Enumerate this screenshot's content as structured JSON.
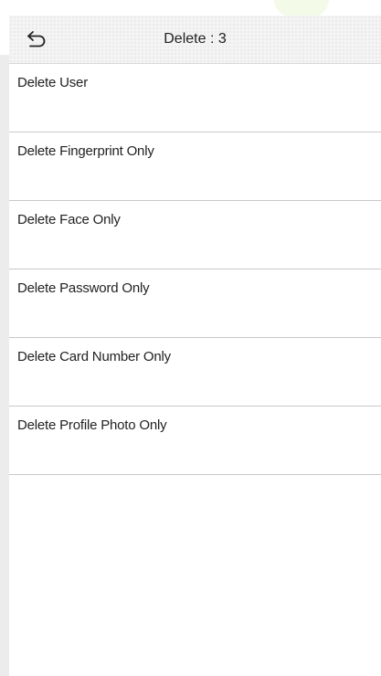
{
  "header": {
    "back_icon": "back-arrow-icon",
    "title": "Delete : 3"
  },
  "menu": {
    "items": [
      {
        "label": "Delete User"
      },
      {
        "label": "Delete Fingerprint Only"
      },
      {
        "label": "Delete Face Only"
      },
      {
        "label": "Delete Password Only"
      },
      {
        "label": "Delete Card Number Only"
      },
      {
        "label": "Delete Profile Photo Only"
      }
    ]
  },
  "colors": {
    "background": "#ffffff",
    "header_bg": "#f4f4f4",
    "divider": "#c8c8c8",
    "text": "#222222"
  }
}
